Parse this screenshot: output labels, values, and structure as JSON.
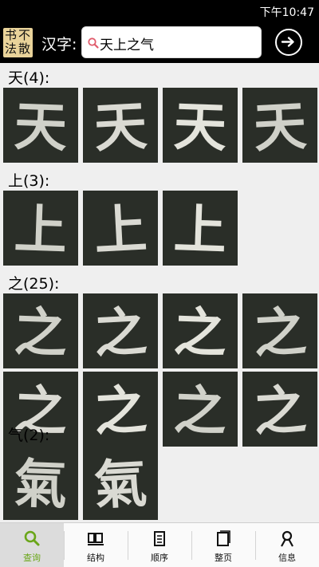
{
  "status": {
    "time": "下午10:47"
  },
  "header": {
    "logo_chars": [
      "书",
      "不",
      "法",
      "散"
    ],
    "label": "汉字:",
    "search_value": "天上之气",
    "go_icon": "arrow-right-circle-icon"
  },
  "sections": [
    {
      "title": "天(4):",
      "char": "天",
      "tiles": 4
    },
    {
      "title": "上(3):",
      "char": "上",
      "tiles": 3
    },
    {
      "title": "之(25):",
      "char": "之",
      "tiles": 8
    },
    {
      "title": "气(2):",
      "char": "氣",
      "tiles": 2
    }
  ],
  "nav": [
    {
      "label": "查询",
      "icon": "search-icon",
      "selected": true
    },
    {
      "label": "结构",
      "icon": "structure-icon",
      "selected": false
    },
    {
      "label": "顺序",
      "icon": "order-icon",
      "selected": false
    },
    {
      "label": "整页",
      "icon": "page-icon",
      "selected": false
    },
    {
      "label": "信息",
      "icon": "info-icon",
      "selected": false
    }
  ],
  "colors": {
    "accent": "#6aa619",
    "tile_bg": "#2a2e28",
    "header_bg": "#000000"
  }
}
